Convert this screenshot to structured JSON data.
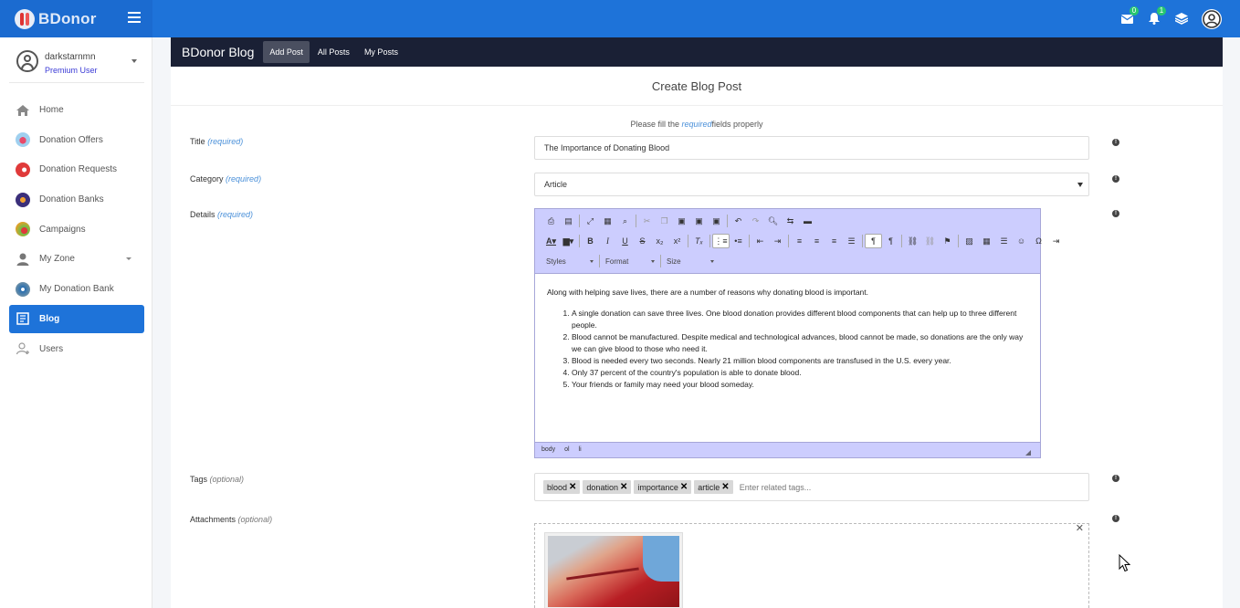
{
  "app": {
    "brand": "BDonor",
    "notifications": {
      "messages_count": "0",
      "alerts_count": "1"
    }
  },
  "sidebar": {
    "user": {
      "name": "darkstarnmn",
      "role": "Premium User"
    },
    "items": [
      {
        "label": "Home",
        "icon": "home-icon",
        "color": "#888888"
      },
      {
        "label": "Donation Offers",
        "icon": "heart-offer-icon",
        "color": "#e84a6a"
      },
      {
        "label": "Donation Requests",
        "icon": "request-icon",
        "color": "#e03a3a"
      },
      {
        "label": "Donation Banks",
        "icon": "bank-icon",
        "color": "#3b2f7a"
      },
      {
        "label": "Campaigns",
        "icon": "campaign-icon",
        "color": "#e2a02a"
      },
      {
        "label": "My Zone",
        "icon": "user-icon",
        "color": "#777777"
      },
      {
        "label": "My Donation Bank",
        "icon": "my-bank-icon",
        "color": "#2a6fb0"
      },
      {
        "label": "Blog",
        "icon": "blog-icon",
        "color": "#ffffff"
      },
      {
        "label": "Users",
        "icon": "users-icon",
        "color": "#999999"
      }
    ],
    "active_index": 7
  },
  "blog_header": {
    "title": "BDonor Blog",
    "tabs": [
      {
        "label": "Add Post"
      },
      {
        "label": "All Posts"
      },
      {
        "label": "My Posts"
      }
    ]
  },
  "form": {
    "title": "Create Blog Post",
    "notice_prefix": "Please fill the ",
    "notice_req": "required",
    "notice_suffix": "fields properly",
    "title_label": "Title",
    "required_text": "(required)",
    "optional_text": "(optional)",
    "title_value": "The Importance of Donating Blood",
    "category_label": "Category",
    "category_value": "Article",
    "details_label": "Details",
    "tags_label": "Tags",
    "tags": [
      "blood",
      "donation",
      "importance",
      "article"
    ],
    "tags_placeholder": "Enter related tags...",
    "attachments_label": "Attachments"
  },
  "editor": {
    "combos": {
      "styles": "Styles",
      "format": "Format",
      "size": "Size"
    },
    "intro": "Along with helping save lives, there are a number of reasons why donating blood is important.",
    "list": [
      "A single donation can save three lives. One blood donation provides different blood components that can help up to three different people.",
      "Blood cannot be manufactured. Despite medical and technological advances, blood cannot be made, so donations are the only way we can give blood to those who need it.",
      "Blood is needed every two seconds. Nearly 21 million blood components are transfused in the U.S. every year.",
      "Only 37 percent of the country's population is able to donate blood.",
      "Your friends or family may need your blood someday."
    ],
    "status_path": [
      "body",
      "ol",
      "li"
    ]
  },
  "colors": {
    "topbar": "#1e73d9",
    "blog_header": "#1a2035",
    "editor_toolbar": "#cccdfe",
    "required_accent": "#4a90d9"
  }
}
